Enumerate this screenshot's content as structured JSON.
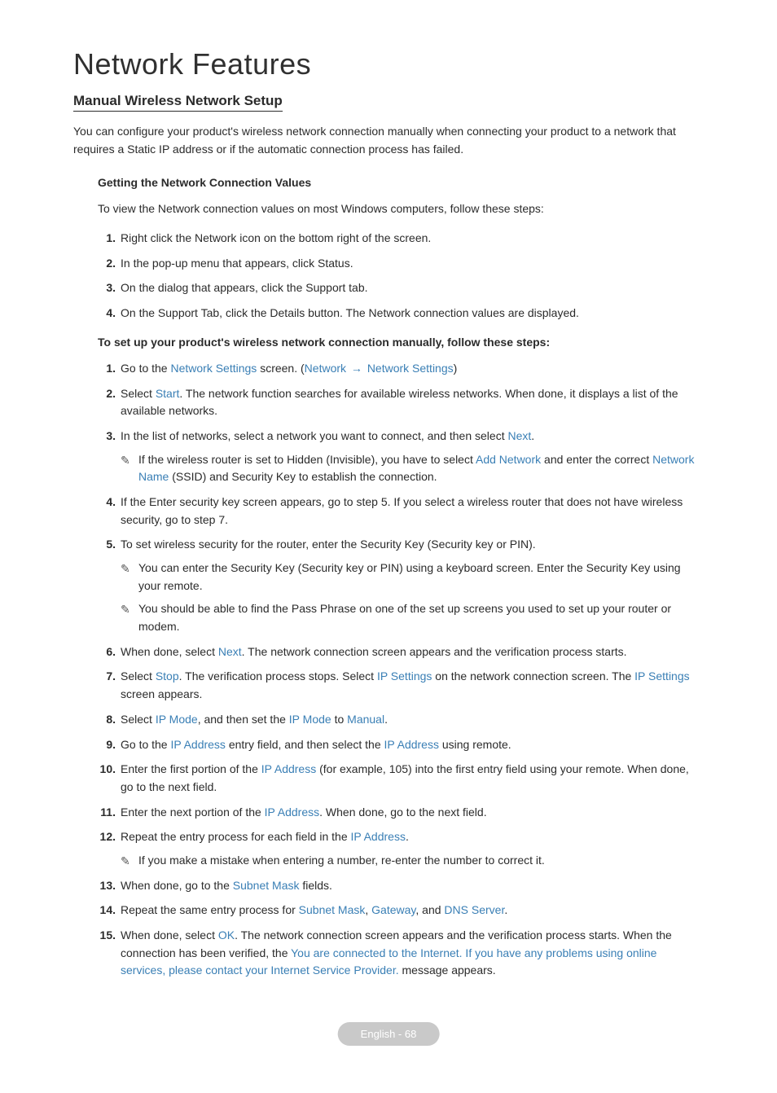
{
  "title": "Network Features",
  "subtitle": "Manual Wireless Network Setup",
  "intro": "You can configure your product's wireless network connection manually when connecting your product to a network that requires a Static IP address or if the automatic connection process has failed.",
  "sec1": {
    "title": "Getting the Network Connection Values",
    "desc": "To view the Network connection values on most Windows computers, follow these steps:",
    "steps": [
      "Right click the Network icon on the bottom right of the screen.",
      "In the pop-up menu that appears, click Status.",
      "On the dialog that appears, click the Support tab.",
      "On the Support Tab, click the Details button. The Network connection values are displayed."
    ]
  },
  "sec2": {
    "title": "To set up your product's wireless network connection manually, follow these steps:",
    "s1a": "Go to the ",
    "s1b": "Network Settings",
    "s1c": " screen. (",
    "s1d": "Network",
    "s1e": "Network Settings",
    "s1f": ")",
    "s2a": "Select ",
    "s2b": "Start",
    "s2c": ". The network function searches for available wireless networks. When done, it displays a list of the available networks.",
    "s3a": "In the list of networks, select a network you want to connect, and then select ",
    "s3b": "Next",
    "s3c": ".",
    "s3n1a": "If the wireless router is set to Hidden (Invisible), you have to select ",
    "s3n1b": "Add Network",
    "s3n1c": " and enter the correct ",
    "s3n1d": "Network Name",
    "s3n1e": " (SSID) and Security Key to establish the connection.",
    "s4": "If the Enter security key screen appears, go to step 5. If you select a wireless router that does not have wireless security, go to step 7.",
    "s5": "To set wireless security for the router, enter the Security Key (Security key or PIN).",
    "s5n1": "You can enter the Security Key (Security key or PIN) using a keyboard screen. Enter the Security Key using your remote.",
    "s5n2": "You should be able to find the Pass Phrase on one of the set up screens you used to set up your router or modem.",
    "s6a": "When done, select ",
    "s6b": "Next",
    "s6c": ". The network connection screen appears and the verification process starts.",
    "s7a": "Select ",
    "s7b": "Stop",
    "s7c": ". The verification process stops. Select ",
    "s7d": "IP Settings",
    "s7e": " on the network connection screen. The ",
    "s7f": "IP Settings",
    "s7g": " screen appears.",
    "s8a": "Select ",
    "s8b": "IP Mode",
    "s8c": ", and then set the ",
    "s8d": "IP Mode",
    "s8e": " to ",
    "s8f": "Manual",
    "s8g": ".",
    "s9a": "Go to the ",
    "s9b": "IP Address",
    "s9c": " entry field, and then select the ",
    "s9d": "IP Address",
    "s9e": " using remote.",
    "s10a": "Enter the first portion of the ",
    "s10b": "IP Address",
    "s10c": " (for example, 105) into the first entry field using your remote. When done, go to the next field.",
    "s11a": "Enter the next portion of the ",
    "s11b": "IP Address",
    "s11c": ". When done, go to the next field.",
    "s12a": "Repeat the entry process for each field in the ",
    "s12b": "IP Address",
    "s12c": ".",
    "s12n1": "If you make a mistake when entering a number, re-enter the number to correct it.",
    "s13a": "When done, go to the ",
    "s13b": "Subnet Mask",
    "s13c": " fields.",
    "s14a": "Repeat the same entry process for ",
    "s14b": "Subnet Mask",
    "s14c": ", ",
    "s14d": "Gateway",
    "s14e": ", and ",
    "s14f": "DNS Server",
    "s14g": ".",
    "s15a": "When done, select ",
    "s15b": "OK",
    "s15c": ". The network connection screen appears and the verification process starts. When the connection has been verified, the ",
    "s15d": "You are connected to the Internet. If you have any problems using online services, please contact your Internet Service Provider.",
    "s15e": " message appears."
  },
  "footer": "English - 68"
}
